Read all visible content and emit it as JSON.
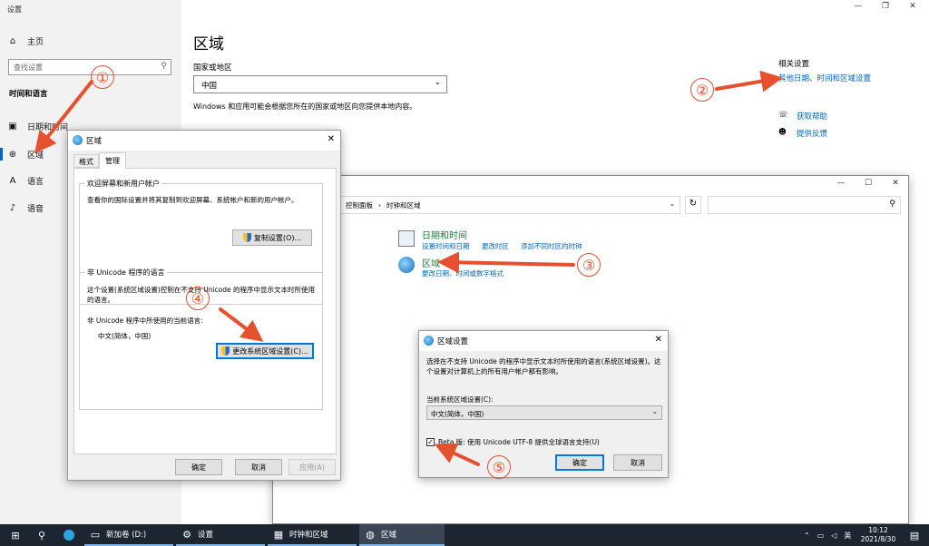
{
  "settings": {
    "window_title": "设置",
    "home": "主页",
    "search_placeholder": "查找设置",
    "section": "时间和语言",
    "nav": [
      "日期和时间",
      "区域",
      "语言",
      "语音"
    ],
    "page_title": "区域",
    "country_label": "国家或地区",
    "country_value": "中国",
    "country_desc": "Windows 和应用可能会根据您所在的国家或地区向您提供本地内容。",
    "related_head": "相关设置",
    "related_link": "其他日期、时间和区域设置",
    "help": "获取帮助",
    "feedback": "提供反馈"
  },
  "region_dialog": {
    "title": "区域",
    "tabs": [
      "格式",
      "管理"
    ],
    "welcome_group": "欢迎屏幕和新用户帐户",
    "welcome_desc": "查看你的国际设置并将其复制到欢迎屏幕、系统帐户和新的用户帐户。",
    "copy_btn": "复制设置(O)...",
    "unicode_group": "非 Unicode 程序的语言",
    "unicode_desc": "这个设置(系统区域设置)控制在不支持 Unicode 的程序中显示文本时所使用的语言。",
    "current_label": "非 Unicode 程序中所使用的当前语言:",
    "current_value": "中文(简体，中国)",
    "change_btn": "更改系统区域设置(C)...",
    "ok": "确定",
    "cancel": "取消",
    "apply": "应用(A)"
  },
  "control_panel": {
    "breadcrumb": [
      "控制面板",
      "时钟和区域"
    ],
    "datetime_title": "日期和时间",
    "datetime_links": [
      "设置时间和日期",
      "更改时区",
      "添加不同时区的时钟"
    ],
    "region_title": "区域",
    "region_link": "更改日期、时间或数字格式"
  },
  "locale_dialog": {
    "title": "区域设置",
    "desc": "选择在不支持 Unicode 的程序中显示文本时所使用的语言(系统区域设置)。这个设置对计算机上的所有用户帐户都有影响。",
    "current_label": "当前系统区域设置(C):",
    "current_value": "中文(简体，中国)",
    "beta_label": "Beta 版: 使用 Unicode UTF-8 提供全球语言支持(U)",
    "beta_checked": true,
    "ok": "确定",
    "cancel": "取消"
  },
  "annotations": [
    "①",
    "②",
    "③",
    "④",
    "⑤"
  ],
  "taskbar": {
    "items": [
      "新加卷 (D:)",
      "设置",
      "时钟和区域",
      "区域"
    ],
    "ime": "英",
    "time": "10:12",
    "date": "2021/8/30"
  },
  "colors": {
    "accent": "#0067c0",
    "arrow": "#e5502e",
    "taskbar": "#1c2530"
  }
}
